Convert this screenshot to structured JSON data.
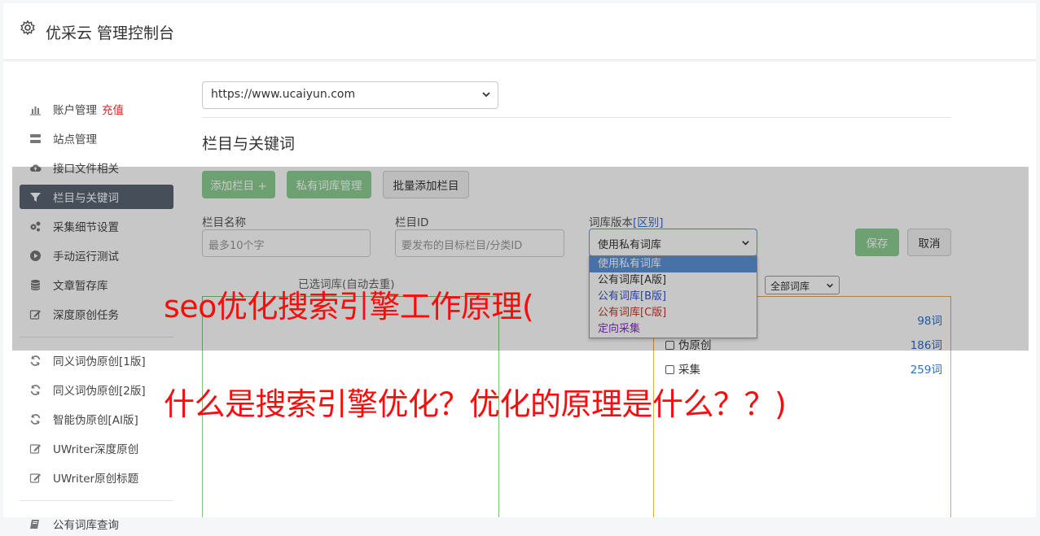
{
  "header": {
    "title": "优采云 管理控制台"
  },
  "sidebar": {
    "items": [
      {
        "label": "账户管理",
        "badge": "充值"
      },
      {
        "label": "站点管理"
      },
      {
        "label": "接口文件相关"
      },
      {
        "label": "栏目与关键词"
      },
      {
        "label": "采集细节设置"
      },
      {
        "label": "手动运行测试"
      },
      {
        "label": "文章暂存库"
      },
      {
        "label": "深度原创任务"
      },
      {
        "label": "同义词伪原创[1版]"
      },
      {
        "label": "同义词伪原创[2版]"
      },
      {
        "label": "智能伪原创[AI版]"
      },
      {
        "label": "UWriter深度原创"
      },
      {
        "label": "UWriter原创标题"
      },
      {
        "label": "公有词库查询"
      }
    ]
  },
  "main": {
    "site_select": "https://www.ucaiyun.com",
    "section_title": "栏目与关键词",
    "buttons": {
      "add_column": "添加栏目 +",
      "private_lib": "私有词库管理",
      "batch_add": "批量添加栏目",
      "save": "保存",
      "cancel": "取消"
    },
    "form": {
      "name_label": "栏目名称",
      "name_placeholder": "最多10个字",
      "id_label": "栏目ID",
      "id_placeholder": "要发布的目标栏目/分类ID",
      "version_label": "词库版本",
      "version_link": "[区别]",
      "version_selected": "使用私有词库",
      "version_options": [
        "使用私有词库",
        "公有词库[A版]",
        "公有词库[B版]",
        "公有词库[C版]",
        "定向采集"
      ]
    },
    "list_label": "已选词库(自动去重)",
    "lib_filter": "全部词库",
    "libraries": [
      {
        "name": "",
        "count": "98词"
      },
      {
        "name": "伪原创",
        "count": "186词"
      },
      {
        "name": "采集",
        "count": "259词"
      }
    ]
  },
  "watermark": {
    "line1": "seo优化搜索引擎工作原理(",
    "line2": "什么是搜索引擎优化？优化的原理是什么？？)"
  }
}
